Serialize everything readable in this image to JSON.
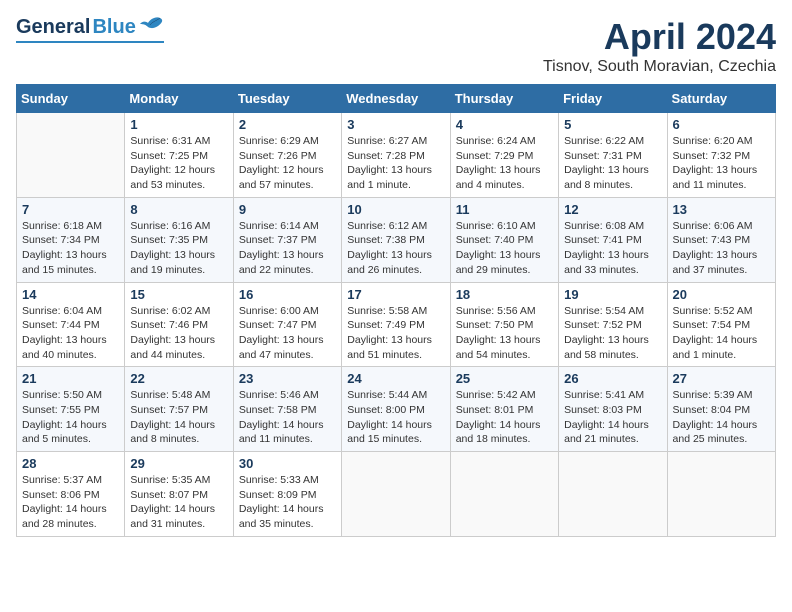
{
  "header": {
    "logo_general": "General",
    "logo_blue": "Blue",
    "month_title": "April 2024",
    "location": "Tisnov, South Moravian, Czechia"
  },
  "columns": [
    "Sunday",
    "Monday",
    "Tuesday",
    "Wednesday",
    "Thursday",
    "Friday",
    "Saturday"
  ],
  "weeks": [
    [
      {
        "day": "",
        "info": ""
      },
      {
        "day": "1",
        "info": "Sunrise: 6:31 AM\nSunset: 7:25 PM\nDaylight: 12 hours\nand 53 minutes."
      },
      {
        "day": "2",
        "info": "Sunrise: 6:29 AM\nSunset: 7:26 PM\nDaylight: 12 hours\nand 57 minutes."
      },
      {
        "day": "3",
        "info": "Sunrise: 6:27 AM\nSunset: 7:28 PM\nDaylight: 13 hours\nand 1 minute."
      },
      {
        "day": "4",
        "info": "Sunrise: 6:24 AM\nSunset: 7:29 PM\nDaylight: 13 hours\nand 4 minutes."
      },
      {
        "day": "5",
        "info": "Sunrise: 6:22 AM\nSunset: 7:31 PM\nDaylight: 13 hours\nand 8 minutes."
      },
      {
        "day": "6",
        "info": "Sunrise: 6:20 AM\nSunset: 7:32 PM\nDaylight: 13 hours\nand 11 minutes."
      }
    ],
    [
      {
        "day": "7",
        "info": "Sunrise: 6:18 AM\nSunset: 7:34 PM\nDaylight: 13 hours\nand 15 minutes."
      },
      {
        "day": "8",
        "info": "Sunrise: 6:16 AM\nSunset: 7:35 PM\nDaylight: 13 hours\nand 19 minutes."
      },
      {
        "day": "9",
        "info": "Sunrise: 6:14 AM\nSunset: 7:37 PM\nDaylight: 13 hours\nand 22 minutes."
      },
      {
        "day": "10",
        "info": "Sunrise: 6:12 AM\nSunset: 7:38 PM\nDaylight: 13 hours\nand 26 minutes."
      },
      {
        "day": "11",
        "info": "Sunrise: 6:10 AM\nSunset: 7:40 PM\nDaylight: 13 hours\nand 29 minutes."
      },
      {
        "day": "12",
        "info": "Sunrise: 6:08 AM\nSunset: 7:41 PM\nDaylight: 13 hours\nand 33 minutes."
      },
      {
        "day": "13",
        "info": "Sunrise: 6:06 AM\nSunset: 7:43 PM\nDaylight: 13 hours\nand 37 minutes."
      }
    ],
    [
      {
        "day": "14",
        "info": "Sunrise: 6:04 AM\nSunset: 7:44 PM\nDaylight: 13 hours\nand 40 minutes."
      },
      {
        "day": "15",
        "info": "Sunrise: 6:02 AM\nSunset: 7:46 PM\nDaylight: 13 hours\nand 44 minutes."
      },
      {
        "day": "16",
        "info": "Sunrise: 6:00 AM\nSunset: 7:47 PM\nDaylight: 13 hours\nand 47 minutes."
      },
      {
        "day": "17",
        "info": "Sunrise: 5:58 AM\nSunset: 7:49 PM\nDaylight: 13 hours\nand 51 minutes."
      },
      {
        "day": "18",
        "info": "Sunrise: 5:56 AM\nSunset: 7:50 PM\nDaylight: 13 hours\nand 54 minutes."
      },
      {
        "day": "19",
        "info": "Sunrise: 5:54 AM\nSunset: 7:52 PM\nDaylight: 13 hours\nand 58 minutes."
      },
      {
        "day": "20",
        "info": "Sunrise: 5:52 AM\nSunset: 7:54 PM\nDaylight: 14 hours\nand 1 minute."
      }
    ],
    [
      {
        "day": "21",
        "info": "Sunrise: 5:50 AM\nSunset: 7:55 PM\nDaylight: 14 hours\nand 5 minutes."
      },
      {
        "day": "22",
        "info": "Sunrise: 5:48 AM\nSunset: 7:57 PM\nDaylight: 14 hours\nand 8 minutes."
      },
      {
        "day": "23",
        "info": "Sunrise: 5:46 AM\nSunset: 7:58 PM\nDaylight: 14 hours\nand 11 minutes."
      },
      {
        "day": "24",
        "info": "Sunrise: 5:44 AM\nSunset: 8:00 PM\nDaylight: 14 hours\nand 15 minutes."
      },
      {
        "day": "25",
        "info": "Sunrise: 5:42 AM\nSunset: 8:01 PM\nDaylight: 14 hours\nand 18 minutes."
      },
      {
        "day": "26",
        "info": "Sunrise: 5:41 AM\nSunset: 8:03 PM\nDaylight: 14 hours\nand 21 minutes."
      },
      {
        "day": "27",
        "info": "Sunrise: 5:39 AM\nSunset: 8:04 PM\nDaylight: 14 hours\nand 25 minutes."
      }
    ],
    [
      {
        "day": "28",
        "info": "Sunrise: 5:37 AM\nSunset: 8:06 PM\nDaylight: 14 hours\nand 28 minutes."
      },
      {
        "day": "29",
        "info": "Sunrise: 5:35 AM\nSunset: 8:07 PM\nDaylight: 14 hours\nand 31 minutes."
      },
      {
        "day": "30",
        "info": "Sunrise: 5:33 AM\nSunset: 8:09 PM\nDaylight: 14 hours\nand 35 minutes."
      },
      {
        "day": "",
        "info": ""
      },
      {
        "day": "",
        "info": ""
      },
      {
        "day": "",
        "info": ""
      },
      {
        "day": "",
        "info": ""
      }
    ]
  ]
}
